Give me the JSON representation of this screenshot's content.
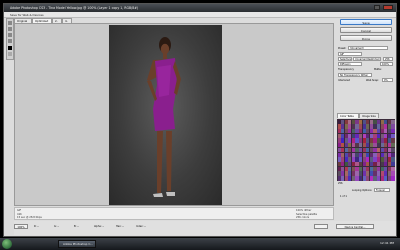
{
  "window": {
    "title": "Adobe Photoshop CS3 - Tina Model Yellow.jpg @ 100% (Layer 1 copy 1, RGB/8#)"
  },
  "menu": [
    "Save for Web & Devices"
  ],
  "doc_tabs": [
    "Original",
    "Optimized",
    "2-Up",
    "4-Up"
  ],
  "buttons": {
    "save": "Save",
    "cancel": "Cancel",
    "done": "Done",
    "device_central": "Device Central..."
  },
  "optimize": {
    "preset_label": "Preset:",
    "preset_value": "[Unnamed]",
    "format": "GIF",
    "reduction": "Selective",
    "reduction_value": "Unnamed Restricted",
    "dither": "Diffusion",
    "dither_amount": "100%",
    "transparency_label": "Transparency",
    "matte_label": "Matte:",
    "no_trans_dither": "No Transparency Dither",
    "interlaced_label": "Interlaced",
    "web_snap_label": "Web Snap:",
    "web_snap_value": "0%"
  },
  "color_table": {
    "tabs": [
      "Color Table",
      "Image Size"
    ],
    "count": "256"
  },
  "looping": {
    "label": "Looping Options:",
    "value": "Forever"
  },
  "frame_counter": "1 of 1",
  "info": {
    "left_format": "GIF",
    "left_size": "41K",
    "left_time": "15 sec @ 28.8 Kbps",
    "right_dither": "100% dither",
    "right_palette": "Selective palette",
    "right_colors": "256 colors"
  },
  "status": {
    "zoom": "100%",
    "r": "R: --",
    "g": "G: --",
    "b": "B: --",
    "alpha": "Alpha: --",
    "hex": "Hex: --",
    "index": "Index: --"
  },
  "taskbar": {
    "app": "Adobe Photoshop C...",
    "clock": "12:41 PM"
  },
  "colors": {
    "dress": "#8a1f8e",
    "accent": "#3b7ac7"
  }
}
